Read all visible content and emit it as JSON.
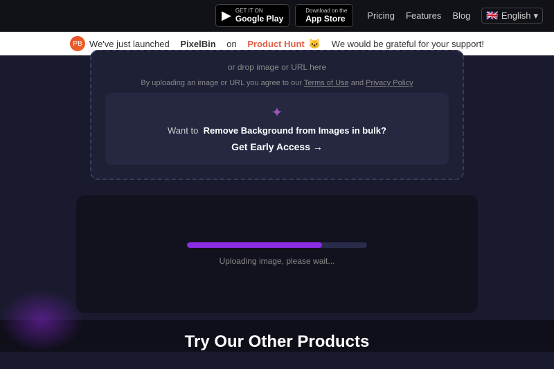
{
  "navbar": {
    "google_play": {
      "top": "GET IT ON",
      "name": "Google Play"
    },
    "app_store": {
      "top": "Download on the",
      "name": "App Store"
    },
    "links": {
      "pricing": "Pricing",
      "features": "Features",
      "blog": "Blog"
    },
    "lang": {
      "flag": "🇬🇧",
      "label": "English",
      "chevron": "▾"
    }
  },
  "announcement": {
    "text_before": "We've just launched",
    "brand": "PixelBin",
    "text_on": "on",
    "product_hunt_label": "Product Hunt",
    "product_hunt_icon": "🐱",
    "text_after": "We would be grateful for your support!"
  },
  "upload_card": {
    "drop_text": "or drop image or URL here",
    "terms_text": "By uploading an image or URL you agree to our",
    "terms_of_use": "Terms of Use",
    "and": "and",
    "privacy_policy": "Privacy Policy"
  },
  "bulk_section": {
    "icon": "✦",
    "text": "Want to",
    "bold": "Remove Background from Images in bulk?",
    "cta": "Get Early Access →"
  },
  "progress": {
    "label": "Uploading image, please wait...",
    "percent": 75
  },
  "other_products": {
    "title": "Try Our Other Products"
  }
}
